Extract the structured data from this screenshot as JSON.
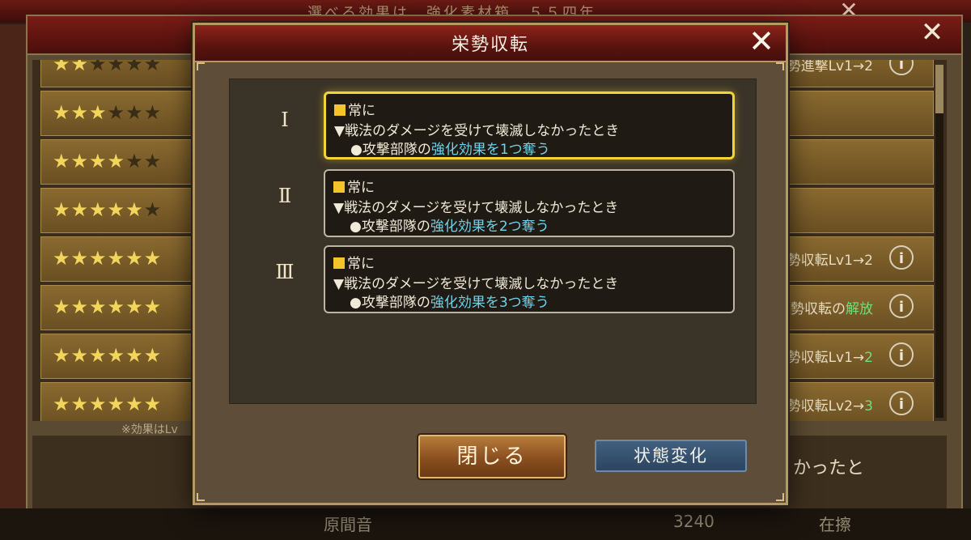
{
  "background": {
    "screen_title": "選べる効果は、強化素材箱…５５四年",
    "note": "※効果はLv",
    "lower_text": "かったと",
    "rows": [
      {
        "stars_on": 2,
        "stars_off": 4,
        "text": "装備技能威勢進撃Lv1→2",
        "text_hl": ""
      },
      {
        "stars_on": 3,
        "stars_off": 3,
        "text": "",
        "text_hl": ""
      },
      {
        "stars_on": 4,
        "stars_off": 2,
        "text": "",
        "text_hl": ""
      },
      {
        "stars_on": 5,
        "stars_off": 1,
        "text": "",
        "text_hl": ""
      },
      {
        "stars_on": 6,
        "stars_off": 0,
        "text": "装備技能栄勢収転Lv1→2",
        "text_hl": ""
      },
      {
        "stars_on": 6,
        "stars_off": 0,
        "text": "装備技能栄勢収転の",
        "text_hl": "解放"
      },
      {
        "stars_on": 6,
        "stars_off": 0,
        "text": "装備技能栄勢収転Lv1→",
        "text_hl": "2"
      },
      {
        "stars_on": 6,
        "stars_off": 0,
        "text": "装備技能栄勢収転Lv2→",
        "text_hl": "3"
      }
    ],
    "info_icon": "i",
    "bottom_left": "原間音",
    "bottom_mid": "3240",
    "bottom_right": "在擦"
  },
  "dialog": {
    "title": "栄勢収転",
    "close_icon": "✕",
    "levels": [
      {
        "numeral": "Ⅰ",
        "selected": true,
        "condition": "常に",
        "trigger": "▼戦法のダメージを受けて壊滅しなかったとき",
        "effect_prefix": "●攻撃部隊の",
        "effect_highlight": "強化効果を1つ奪う"
      },
      {
        "numeral": "Ⅱ",
        "selected": false,
        "condition": "常に",
        "trigger": "▼戦法のダメージを受けて壊滅しなかったとき",
        "effect_prefix": "●攻撃部隊の",
        "effect_highlight": "強化効果を2つ奪う"
      },
      {
        "numeral": "Ⅲ",
        "selected": false,
        "condition": "常に",
        "trigger": "▼戦法のダメージを受けて壊滅しなかったとき",
        "effect_prefix": "●攻撃部隊の",
        "effect_highlight": "強化効果を3つ奪う"
      }
    ],
    "close_button_label": "閉じる",
    "change_button_label": "状態変化"
  },
  "colors": {
    "selected_border": "#f3d435",
    "highlight_text": "#6fd3ea",
    "condition_square": "#f3c52a",
    "green_text": "#6ee07a"
  }
}
